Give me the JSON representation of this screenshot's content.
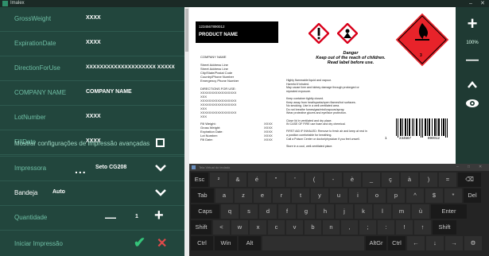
{
  "window": {
    "title": "Imalex",
    "controls": [
      "–",
      "✕"
    ]
  },
  "form": {
    "rows": [
      {
        "label": "GrossWeight",
        "value": "XXXX"
      },
      {
        "label": "ExpirationDate",
        "value": "XXXX"
      },
      {
        "label": "DirectionForUse",
        "value": "XXXXXXXXXXXXXXXXXXXX XXXXX"
      },
      {
        "label": "COMPANY NAME",
        "value": "COMPANY NAME"
      },
      {
        "label": "LotNumber",
        "value": "XXXX"
      },
      {
        "label": "FillDate",
        "value": "XXXX"
      }
    ],
    "advanced_label": "Mostrar configurações de impressão avançadas",
    "printer": {
      "label": "Impressora",
      "dots": "...",
      "value": "Seto CG208"
    },
    "tray": {
      "label": "Bandeja",
      "value": "Auto"
    },
    "quantity": {
      "label": "Quantidade",
      "minus": "—",
      "value": "1",
      "plus": "+"
    },
    "start": {
      "label": "Iniciar Impressão",
      "ok": "✔",
      "cancel": "✕"
    }
  },
  "rightbar": {
    "zoom_in": "+",
    "zoom_level": "100%",
    "zoom_out": "—",
    "up": "^",
    "eye": "◉"
  },
  "preview": {
    "header_code": "1234567890012",
    "product_name": "PRODUCT NAME",
    "danger": "Danger",
    "warning1": "Keep out of the reach of children.",
    "warning2": "Read label before use.",
    "company_block": [
      "COMPANY NAME",
      "",
      "Street Address Line",
      "Street Address Line",
      "City/State/Postal Code",
      "Country/Phone Number",
      "Emergency Phone Number",
      "",
      "DIRECTIONS FOR USE:",
      "XXXXXXXXXXXXXXXXX",
      "XXX",
      "XXXXXXXXXXXXXXXXX",
      "XXXXXXXXXXXXXXXXX",
      "XXX",
      "XXXXXXXXXXXXXXXXX",
      "XXX"
    ],
    "fields": [
      {
        "k": "Fill Weight:",
        "v": "XXXX"
      },
      {
        "k": "Gross Weight:",
        "v": "XXXX"
      },
      {
        "k": "Expiration Date:",
        "v": "XXXX"
      },
      {
        "k": "Lot Number:",
        "v": "XXXX"
      },
      {
        "k": "Fill Date:",
        "v": "XXXX"
      }
    ],
    "hazard_text": [
      "Highly flammable liquid and vapour.",
      "Harmful if inhaled.",
      "May cause liver and kidney damage through prolonged or",
      "repeated exposure.",
      "",
      "Keep container tightly closed.",
      "Keep away from heat/sparks/open flames/hot surfaces.",
      "No smoking. Use in a well-ventilated area.",
      "Do not breathe fumes/gas/mist/vapours/spray.",
      "Wear protective gloves and eye/face protection.",
      "",
      "Close lid in ventilated and dry place.",
      "IN CASE OF FIRE use foam and dry chemical.",
      "",
      "FIRST AID IF INHALED: Remove to fresh air and keep at rest in",
      "a position comfortable for breathing.",
      "Call a Poison Center or doctor/physician if you feel unwell.",
      "",
      "Store in a cool, well-ventilated place."
    ],
    "barcode_digits": [
      "1",
      "234567",
      "890012"
    ],
    "class_number": "3"
  },
  "keyboard": {
    "title": "Tela Virtual do teclado",
    "controls": [
      "–",
      "□",
      "✕"
    ],
    "row1": [
      {
        "k": "Esc",
        "s": ""
      },
      {
        "k": "²",
        "s": ""
      },
      {
        "k": "&",
        "s": ""
      },
      {
        "k": "é",
        "s": ""
      },
      {
        "k": "\"",
        "s": ""
      },
      {
        "k": "'",
        "s": ""
      },
      {
        "k": "(",
        "s": ""
      },
      {
        "k": "-",
        "s": ""
      },
      {
        "k": "è",
        "s": ""
      },
      {
        "k": "_",
        "s": ""
      },
      {
        "k": "ç",
        "s": ""
      },
      {
        "k": "à",
        "s": ""
      },
      {
        "k": ")",
        "s": ""
      },
      {
        "k": "=",
        "s": ""
      },
      {
        "k": "⌫",
        "s": ""
      }
    ],
    "row2": [
      "Tab",
      "a",
      "z",
      "e",
      "r",
      "t",
      "y",
      "u",
      "i",
      "o",
      "p",
      "^",
      "$",
      "*",
      "Del"
    ],
    "row3": [
      "Caps",
      "q",
      "s",
      "d",
      "f",
      "g",
      "h",
      "j",
      "k",
      "l",
      "m",
      "ù",
      "Enter"
    ],
    "row4": [
      "Shift",
      "<",
      "w",
      "x",
      "c",
      "v",
      "b",
      "n",
      ",",
      ";",
      ":",
      "!",
      "↑",
      "Shift"
    ],
    "row5": [
      "Ctrl",
      "Win",
      "Alt",
      "",
      "AltGr",
      "Ctrl",
      "←",
      "↓",
      "→",
      "⚙"
    ]
  }
}
